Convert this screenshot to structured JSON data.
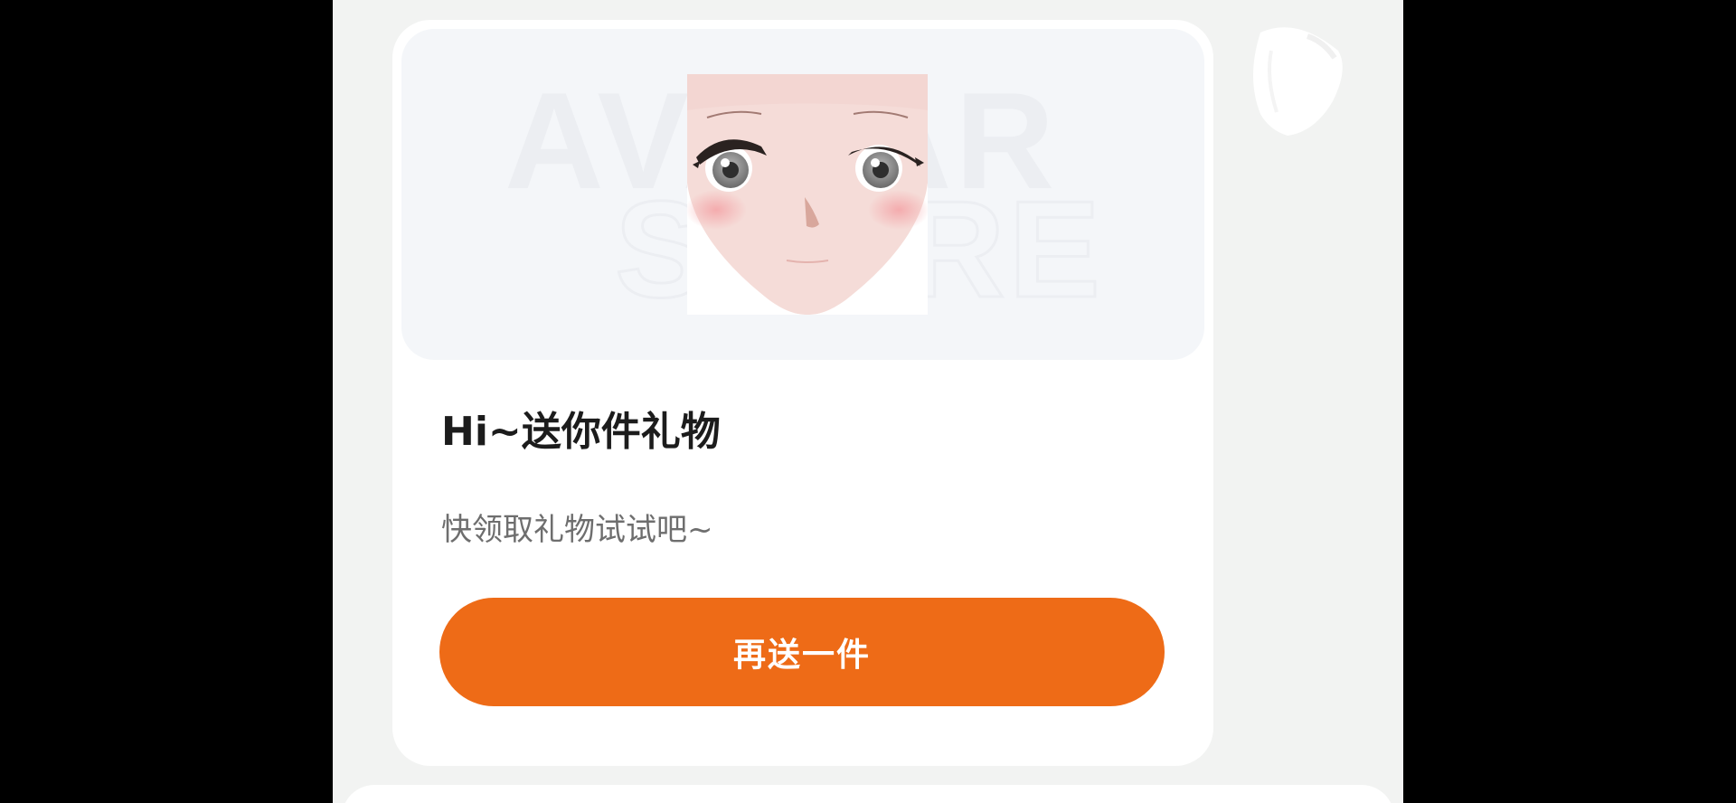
{
  "gift_card": {
    "title": "Hi~送你件礼物",
    "subtitle": "快领取礼物试试吧~",
    "send_again_label": "再送一件",
    "preview": {
      "watermark_line1": "AVATAR",
      "watermark_line2": "STORE",
      "item": "anime-face-avatar"
    }
  },
  "colors": {
    "page_background": "#f2f3f2",
    "card_background": "#ffffff",
    "preview_background": "#f4f6f9",
    "accent": "#ee6b17",
    "title_text": "#1c1c1c",
    "subtitle_text": "#6e6e6e"
  },
  "icons": {
    "side_decoration": "gift-ribbon-icon"
  }
}
